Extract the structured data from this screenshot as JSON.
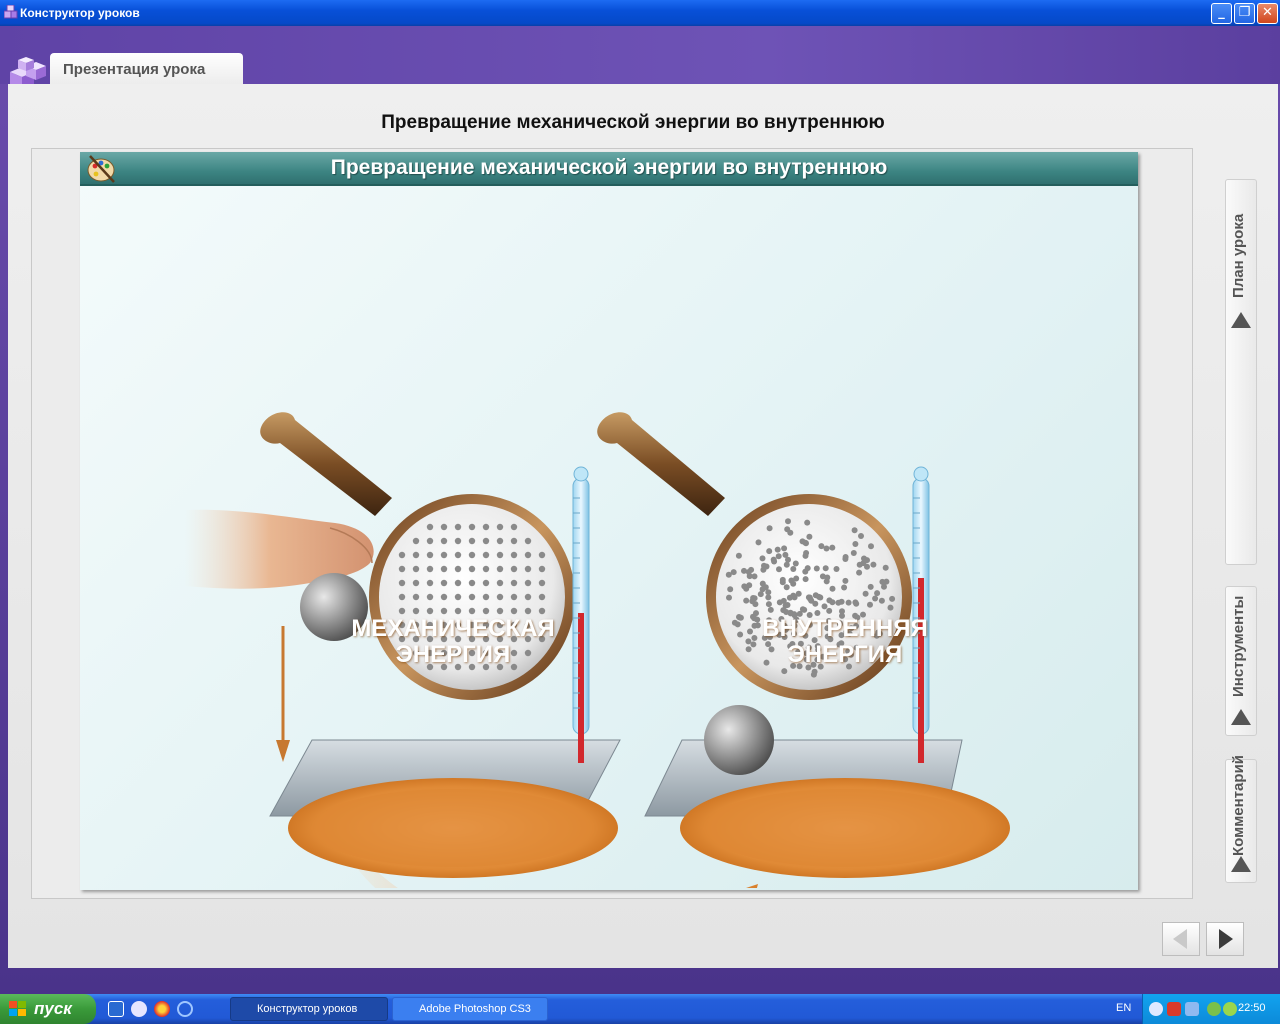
{
  "window": {
    "title": "Конструктор уроков"
  },
  "header": {
    "tab_label": "Презентация урока"
  },
  "lesson": {
    "title": "Превращение механической энергии во внутреннюю"
  },
  "slide": {
    "header_title": "Превращение механической энергии во внутреннюю",
    "left_label_line1": "МЕХАНИЧЕСКАЯ",
    "left_label_line2": "ЭНЕРГИЯ",
    "right_label_line1": "ВНУТРЕННЯЯ",
    "right_label_line2": "ЭНЕРГИЯ"
  },
  "side_tabs": [
    {
      "label": "План урока"
    },
    {
      "label": "Инструменты"
    },
    {
      "label": "Комментарий"
    }
  ],
  "taskbar": {
    "start_label": "пуск",
    "tasks": [
      {
        "label": "Конструктор уроков"
      },
      {
        "label": "Adobe Photoshop CS3"
      }
    ],
    "language": "EN",
    "clock": "22:50"
  }
}
